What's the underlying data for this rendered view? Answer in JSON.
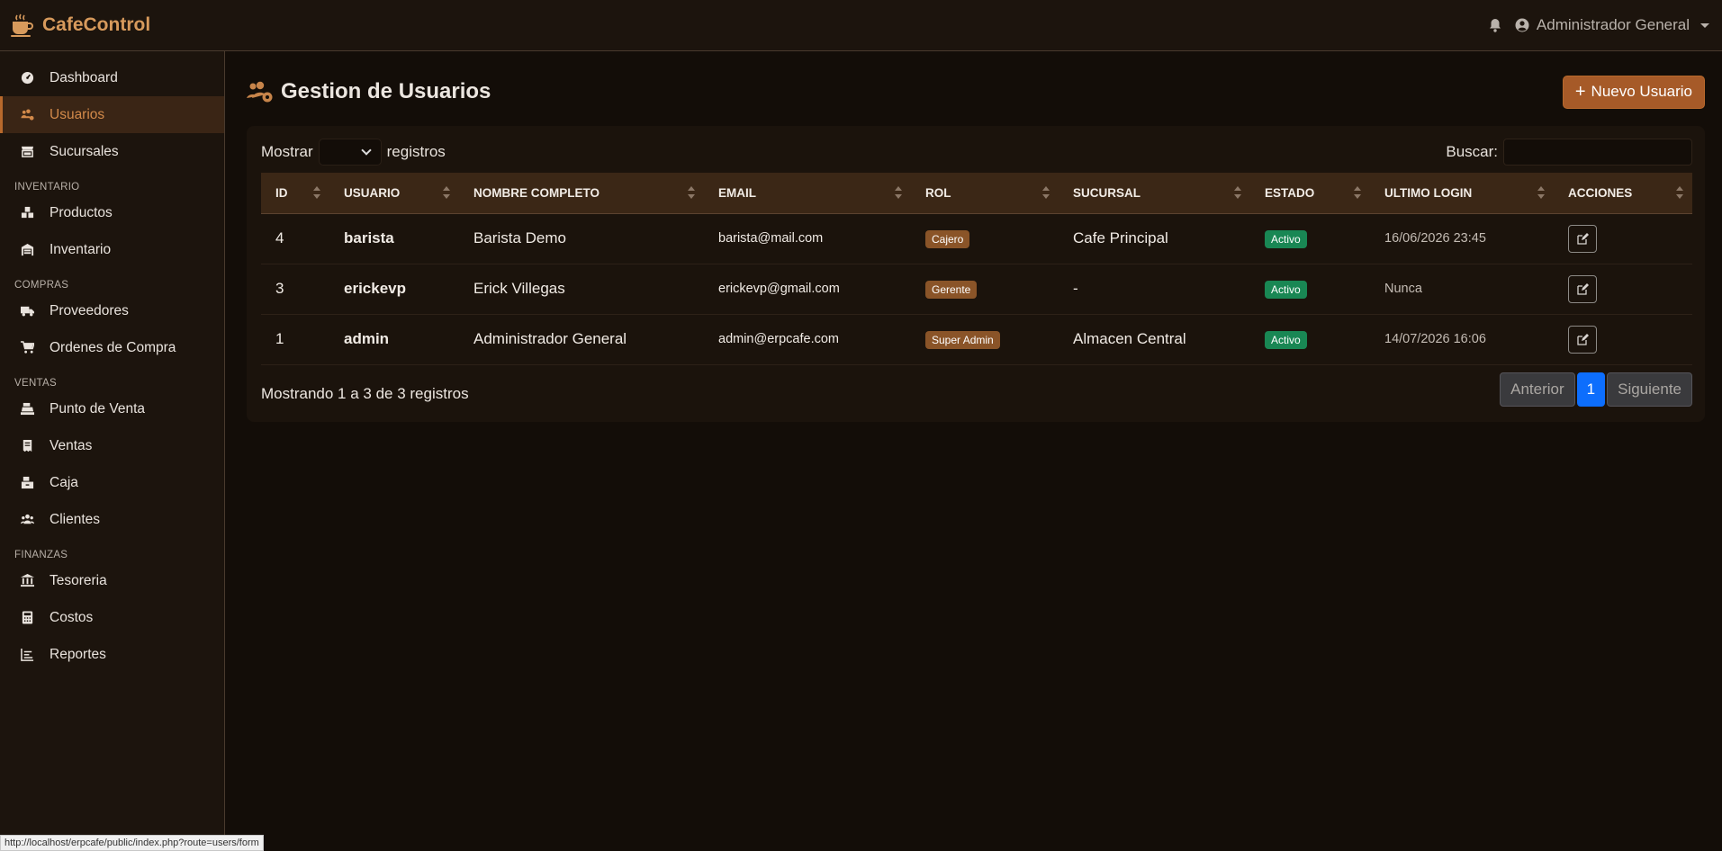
{
  "brand": {
    "name": "CafeControl"
  },
  "topbar": {
    "user_name": "Administrador General"
  },
  "sidebar": {
    "items_main": [
      {
        "label": "Dashboard",
        "icon": "dashboard-icon"
      },
      {
        "label": "Usuarios",
        "icon": "users-cog-icon",
        "active": true
      },
      {
        "label": "Sucursales",
        "icon": "store-icon"
      }
    ],
    "section_inventario": "INVENTARIO",
    "items_inventario": [
      {
        "label": "Productos",
        "icon": "boxes-icon"
      },
      {
        "label": "Inventario",
        "icon": "warehouse-icon"
      }
    ],
    "section_compras": "COMPRAS",
    "items_compras": [
      {
        "label": "Proveedores",
        "icon": "truck-icon"
      },
      {
        "label": "Ordenes de Compra",
        "icon": "cart-icon"
      }
    ],
    "section_ventas": "VENTAS",
    "items_ventas": [
      {
        "label": "Punto de Venta",
        "icon": "cash-register-icon"
      },
      {
        "label": "Ventas",
        "icon": "receipt-icon"
      },
      {
        "label": "Caja",
        "icon": "cash-drawer-icon"
      },
      {
        "label": "Clientes",
        "icon": "users-icon"
      }
    ],
    "section_finanzas": "FINANZAS",
    "items_finanzas": [
      {
        "label": "Tesoreria",
        "icon": "bank-icon"
      },
      {
        "label": "Costos",
        "icon": "calculator-icon"
      },
      {
        "label": "Reportes",
        "icon": "chart-icon"
      }
    ]
  },
  "page": {
    "title": "Gestion de Usuarios",
    "new_button": "Nuevo Usuario"
  },
  "table": {
    "show_label": "Mostrar",
    "records_label": "registros",
    "search_label": "Buscar:",
    "headers": [
      "ID",
      "USUARIO",
      "NOMBRE COMPLETO",
      "EMAIL",
      "ROL",
      "SUCURSAL",
      "ESTADO",
      "ULTIMO LOGIN",
      "ACCIONES"
    ],
    "rows": [
      {
        "id": "4",
        "user": "barista",
        "name": "Barista Demo",
        "email": "barista@mail.com",
        "role": "Cajero",
        "branch": "Cafe Principal",
        "status": "Activo",
        "login": "16/06/2026 23:45"
      },
      {
        "id": "3",
        "user": "erickevp",
        "name": "Erick Villegas",
        "email": "erickevp@gmail.com",
        "role": "Gerente",
        "branch": "-",
        "status": "Activo",
        "login": "Nunca"
      },
      {
        "id": "1",
        "user": "admin",
        "name": "Administrador General",
        "email": "admin@erpcafe.com",
        "role": "Super Admin",
        "branch": "Almacen Central",
        "status": "Activo",
        "login": "14/07/2026 16:06"
      }
    ],
    "info": "Mostrando 1 a 3 de 3 registros",
    "pager": {
      "prev": "Anterior",
      "current": "1",
      "next": "Siguiente"
    }
  },
  "statusbar": {
    "url": "http://localhost/erpcafe/public/index.php?route=users/form"
  },
  "colors": {
    "accent": "#a65a28",
    "brand": "#d79a5c",
    "success": "#198754",
    "page_active": "#0d6efd"
  }
}
